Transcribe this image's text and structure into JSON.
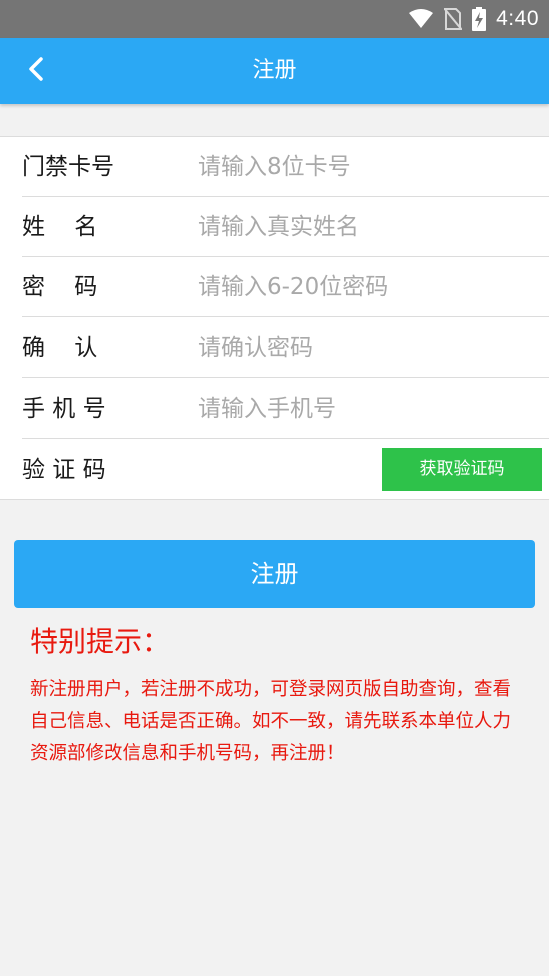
{
  "status_bar": {
    "time": "4:40",
    "icons": [
      "wifi-icon",
      "no-sim-icon",
      "battery-charging-icon"
    ]
  },
  "app_bar": {
    "back_icon": "chevron-left-icon",
    "title": "注册",
    "color": "#2ba8f4"
  },
  "form": {
    "card_number": {
      "label": "门禁卡号",
      "placeholder": "请输入8位卡号",
      "value": ""
    },
    "name": {
      "label": "姓    名",
      "placeholder": "请输入真实姓名",
      "value": ""
    },
    "password": {
      "label": "密    码",
      "placeholder": "请输入6-20位密码",
      "value": ""
    },
    "confirm": {
      "label": "确    认",
      "placeholder": "请确认密码",
      "value": ""
    },
    "phone": {
      "label": "手 机 号",
      "placeholder": "请输入手机号",
      "value": ""
    },
    "code": {
      "label": "验 证 码",
      "button_label": "获取验证码",
      "button_color": "#2ec24a"
    }
  },
  "submit": {
    "label": "注册"
  },
  "notice": {
    "title": "特别提示：",
    "body": "新注册用户，若注册不成功，可登录网页版自助查询，查看自己信息、电话是否正确。如不一致，请先联系本单位人力资源部修改信息和手机号码，再注册！",
    "color": "#e8190f"
  }
}
